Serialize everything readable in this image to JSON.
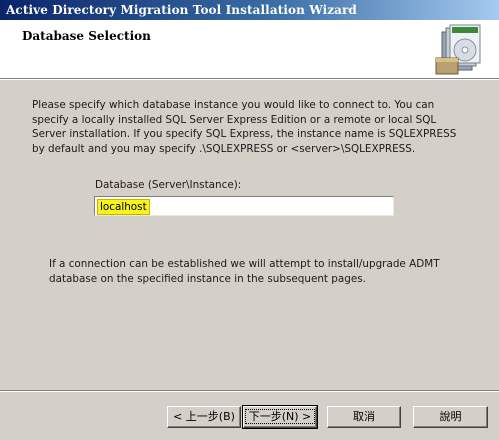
{
  "window": {
    "title": "Active Directory Migration Tool Installation Wizard"
  },
  "header": {
    "title": "Database Selection",
    "icon": "installer-box-icon"
  },
  "body": {
    "description": "Please specify which database instance you would like to connect to. You can specify a locally installed SQL Server Express Edition or a remote or local SQL Server installation. If you specify SQL Express, the instance name is SQLEXPRESS by default and you may specify .\\SQLEXPRESS or <server>\\SQLEXPRESS.",
    "field_label": "Database (Server\\Instance):",
    "field_value": "localhost",
    "note": "If a connection can be established we will attempt to install/upgrade ADMT database on the specified instance in the subsequent pages."
  },
  "buttons": {
    "back": "< 上一步(B)",
    "next": "下一步(N) >",
    "cancel": "取消",
    "help": "說明"
  },
  "colors": {
    "title_gradient_start": "#0a246a",
    "title_gradient_end": "#a6caf0",
    "dialog_bg": "#d4d0c8",
    "highlight": "#f7f41a"
  }
}
